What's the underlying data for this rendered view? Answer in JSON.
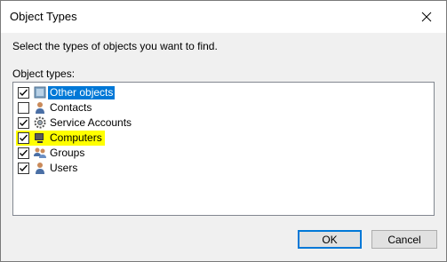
{
  "window": {
    "title": "Object Types",
    "close_icon": "close-icon"
  },
  "instruction": "Select the types of objects you want to find.",
  "list_label": "Object types:",
  "items": [
    {
      "label": "Other objects",
      "checked": true,
      "icon": "other-objects-icon",
      "selected": true,
      "highlighted": false
    },
    {
      "label": "Contacts",
      "checked": false,
      "icon": "contact-icon",
      "selected": false,
      "highlighted": false
    },
    {
      "label": "Service Accounts",
      "checked": true,
      "icon": "service-account-icon",
      "selected": false,
      "highlighted": false
    },
    {
      "label": "Computers",
      "checked": true,
      "icon": "computer-icon",
      "selected": false,
      "highlighted": true
    },
    {
      "label": "Groups",
      "checked": true,
      "icon": "group-icon",
      "selected": false,
      "highlighted": false
    },
    {
      "label": "Users",
      "checked": true,
      "icon": "user-icon",
      "selected": false,
      "highlighted": false
    }
  ],
  "buttons": {
    "ok": "OK",
    "cancel": "Cancel"
  },
  "colors": {
    "selection": "#0078d7",
    "highlight": "#ffff00"
  }
}
